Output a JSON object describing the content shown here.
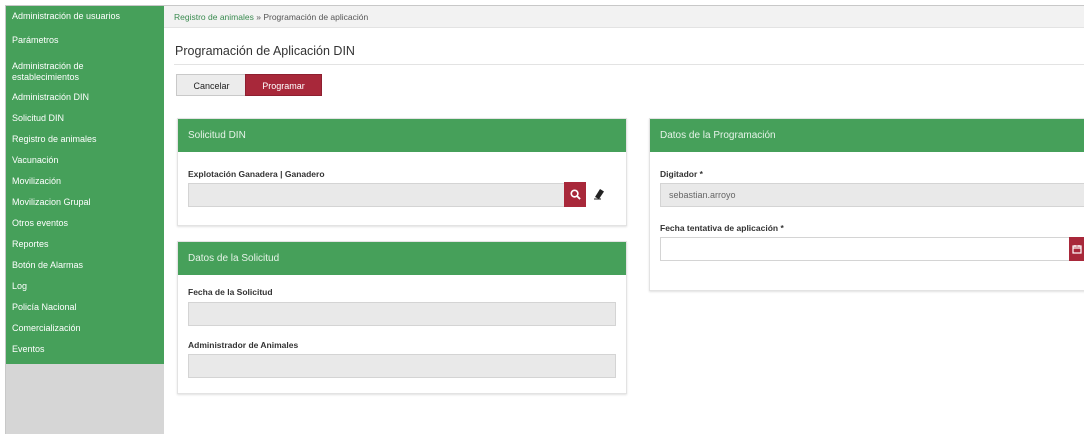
{
  "sidebar": {
    "items": [
      {
        "label": "Administración de usuarios"
      },
      {
        "label": "Parámetros"
      },
      {
        "label": "Administración de"
      },
      {
        "label": "establecimientos"
      },
      {
        "label": "Administración DIN"
      },
      {
        "label": "Solicitud DIN"
      },
      {
        "label": "Registro de animales"
      },
      {
        "label": "Vacunación"
      },
      {
        "label": "Movilización"
      },
      {
        "label": "Movilizacion Grupal"
      },
      {
        "label": "Otros eventos"
      },
      {
        "label": "Reportes"
      },
      {
        "label": "Botón de Alarmas"
      },
      {
        "label": "Log"
      },
      {
        "label": "Policía Nacional"
      },
      {
        "label": "Comercialización"
      },
      {
        "label": "Eventos"
      }
    ]
  },
  "breadcrumb": {
    "link": "Registro de animales",
    "separator": " » ",
    "current": "Programación de aplicación"
  },
  "page": {
    "title": "Programación de Aplicación DIN"
  },
  "actions": {
    "cancel_label": "Cancelar",
    "program_label": "Programar"
  },
  "solicitud_din": {
    "title": "Solicitud DIN",
    "field_label": "Explotación Ganadera | Ganadero",
    "field_value": ""
  },
  "datos_solicitud": {
    "title": "Datos de la Solicitud",
    "fecha_label": "Fecha de la Solicitud",
    "fecha_value": "",
    "admin_label": "Administrador de Animales",
    "admin_value": ""
  },
  "datos_programacion": {
    "title": "Datos de la Programación",
    "digitador_label": "Digitador *",
    "digitador_value": "sebastian.arroyo",
    "fecha_label": "Fecha tentativa de aplicación *",
    "fecha_value": ""
  },
  "icons": [
    "search-icon",
    "eraser-icon",
    "calendar-icon"
  ],
  "colors": {
    "brand_green": "#46a05a",
    "accent_red": "#a8283a",
    "sidebar_gray": "#d6d6d6"
  }
}
